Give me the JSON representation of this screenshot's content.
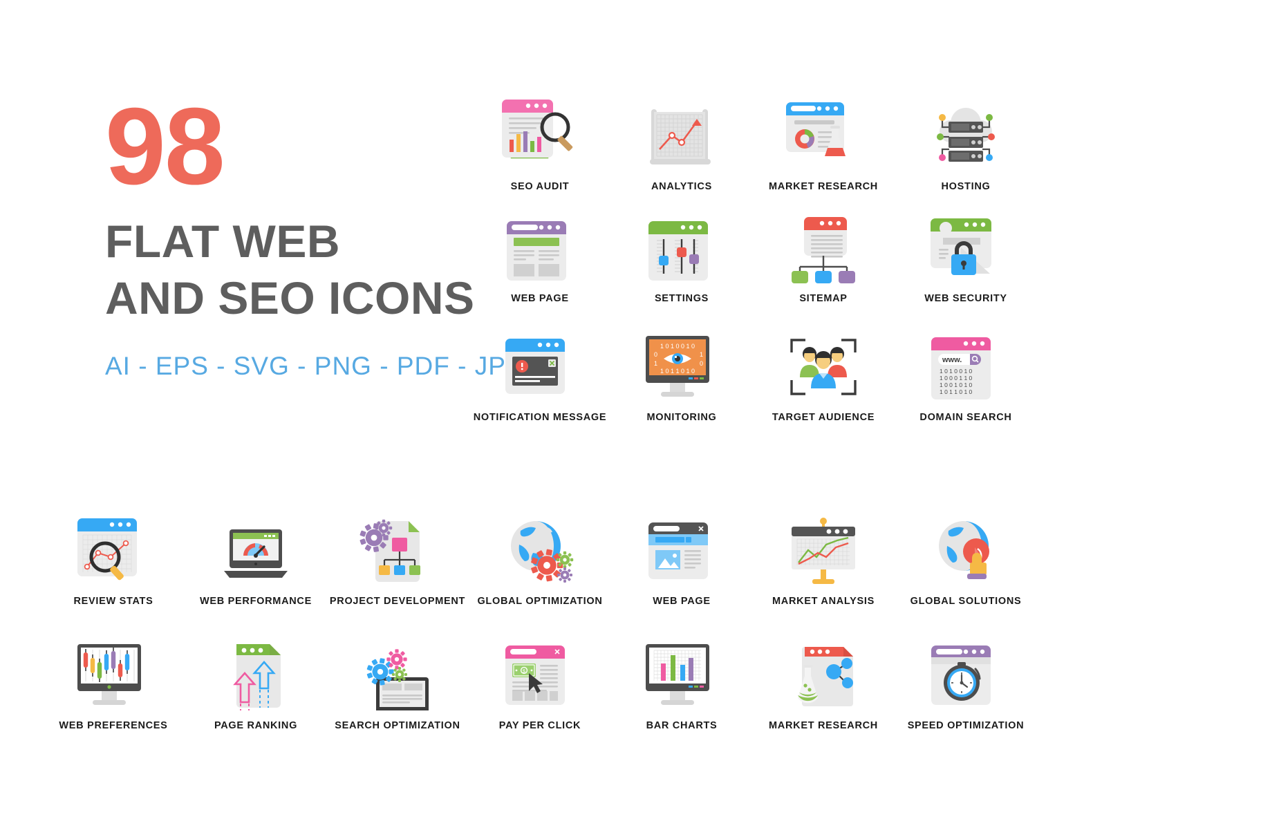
{
  "hero": {
    "count": "98",
    "title_line1": "FLAT WEB",
    "title_line2": "AND SEO ICONS",
    "formats": "AI  -  EPS  -  SVG  -  PNG  -  PDF  -  JPG",
    "count_color": "#ee6a5a",
    "title_color": "#5e5e5e",
    "formats_color": "#57a9e2"
  },
  "icons": [
    {
      "id": "seo-audit",
      "label": "SEO AUDIT",
      "col": 3,
      "row": 1
    },
    {
      "id": "analytics",
      "label": "ANALYTICS",
      "col": 4,
      "row": 1
    },
    {
      "id": "market-research",
      "label": "MARKET RESEARCH",
      "col": 5,
      "row": 1
    },
    {
      "id": "hosting",
      "label": "HOSTING",
      "col": 6,
      "row": 1
    },
    {
      "id": "web-page-1",
      "label": "WEB PAGE",
      "col": 3,
      "row": 2
    },
    {
      "id": "settings",
      "label": "SETTINGS",
      "col": 4,
      "row": 2
    },
    {
      "id": "sitemap",
      "label": "SITEMAP",
      "col": 5,
      "row": 2
    },
    {
      "id": "web-security",
      "label": "WEB SECURITY",
      "col": 6,
      "row": 2
    },
    {
      "id": "notification-message",
      "label": "NOTIFICATION MESSAGE",
      "col": 3,
      "row": 3
    },
    {
      "id": "monitoring",
      "label": "MONITORING",
      "col": 4,
      "row": 3
    },
    {
      "id": "target-audience",
      "label": "TARGET AUDIENCE",
      "col": 5,
      "row": 3
    },
    {
      "id": "domain-search",
      "label": "DOMAIN SEARCH",
      "col": 6,
      "row": 3
    },
    {
      "id": "review-stats",
      "label": "REVIEW STATS",
      "col": 0,
      "row": 4
    },
    {
      "id": "web-performance",
      "label": "WEB PERFORMANCE",
      "col": 1,
      "row": 4
    },
    {
      "id": "project-development",
      "label": "PROJECT DEVELOPMENT",
      "col": 2,
      "row": 4
    },
    {
      "id": "global-optimization",
      "label": "GLOBAL OPTIMIZATION",
      "col": 3,
      "row": 4
    },
    {
      "id": "web-page-2",
      "label": "WEB PAGE",
      "col": 4,
      "row": 4
    },
    {
      "id": "market-analysis",
      "label": "MARKET ANALYSIS",
      "col": 5,
      "row": 4
    },
    {
      "id": "global-solutions",
      "label": "GLOBAL SOLUTIONS",
      "col": 6,
      "row": 4
    },
    {
      "id": "web-preferences",
      "label": "WEB PREFERENCES",
      "col": 0,
      "row": 5
    },
    {
      "id": "page-ranking",
      "label": "PAGE RANKING",
      "col": 1,
      "row": 5
    },
    {
      "id": "search-optimization",
      "label": "SEARCH OPTIMIZATION",
      "col": 2,
      "row": 5
    },
    {
      "id": "pay-per-click",
      "label": "PAY PER CLICK",
      "col": 3,
      "row": 5
    },
    {
      "id": "bar-charts",
      "label": "BAR CHARTS",
      "col": 4,
      "row": 5
    },
    {
      "id": "market-research-2",
      "label": "MARKET RESEARCH",
      "col": 5,
      "row": 5
    },
    {
      "id": "speed-optimization",
      "label": "SPEED OPTIMIZATION",
      "col": 6,
      "row": 5
    }
  ],
  "palette": {
    "pink": "#ef5ba1",
    "pink_light": "#f371b0",
    "blue": "#36a9f4",
    "blue_light": "#7fc9f7",
    "green": "#7cb943",
    "green_light": "#8cc152",
    "red": "#ed5a4d",
    "purple": "#9a7cb5",
    "purple_dark": "#8b6fb0",
    "yellow": "#f5b945",
    "gray_light": "#e8e8e8",
    "gray_mid": "#d0d0d0",
    "gray_dark": "#555555",
    "orange": "#f0914a"
  },
  "domain_search": {
    "url_text": "www.",
    "binary": [
      "1 0 1 0 0 1 0",
      "1 0 0 0 1 1 0",
      "1 0 0 1 0 1 0",
      "1 0 1 1 0 1 0"
    ]
  },
  "monitoring": {
    "binary": [
      "1 0 1 0 0 1 0",
      "0                  1",
      "1                  0",
      "1 0 1 1 0 1 0"
    ]
  }
}
